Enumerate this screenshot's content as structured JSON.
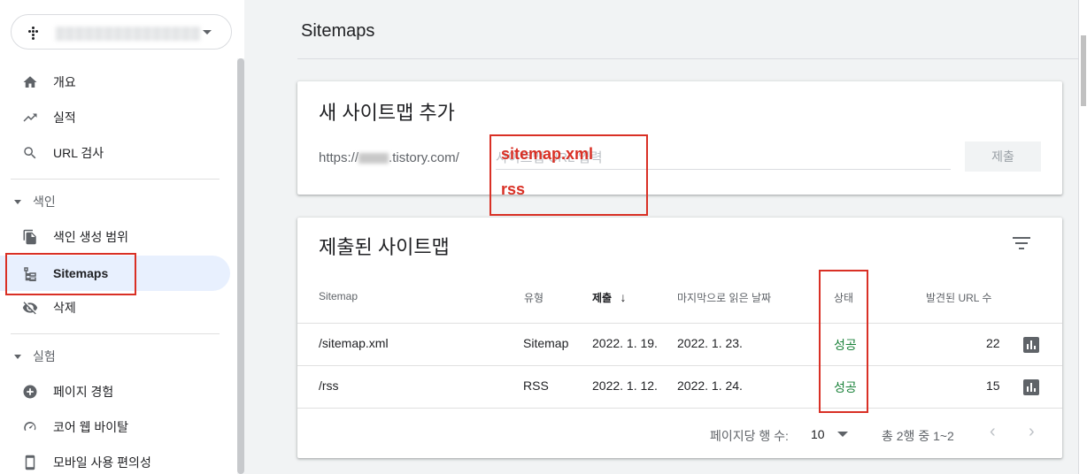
{
  "property": {
    "name": "▒▒▒▒▒▒▒▒▒▒▒▒▒▒▒"
  },
  "sidebar": {
    "items": [
      {
        "label": "개요",
        "icon": "home-icon"
      },
      {
        "label": "실적",
        "icon": "trending-up-icon"
      },
      {
        "label": "URL 검사",
        "icon": "search-icon"
      }
    ],
    "sections": [
      {
        "label": "색인",
        "items": [
          {
            "label": "색인 생성 범위",
            "icon": "file-copy-icon"
          },
          {
            "label": "Sitemaps",
            "icon": "sitemap-icon",
            "active": true
          },
          {
            "label": "삭제",
            "icon": "visibility-off-icon"
          }
        ]
      },
      {
        "label": "실험",
        "items": [
          {
            "label": "페이지 경험",
            "icon": "plus-circle-icon"
          },
          {
            "label": "코어 웹 바이탈",
            "icon": "speed-icon"
          },
          {
            "label": "모바일 사용 편의성",
            "icon": "smartphone-icon"
          }
        ]
      }
    ]
  },
  "main": {
    "title": "Sitemaps",
    "add_card": {
      "title": "새 사이트맵 추가",
      "url_prefix_start": "https://",
      "url_prefix_end": ".tistory.com/",
      "input_placeholder": "사이트맵 URL 입력",
      "submit_label": "제출"
    },
    "annotation": {
      "line1": "sitemap.xml",
      "line2": "rss"
    },
    "submitted_card": {
      "title": "제출된 사이트맵",
      "columns": [
        "Sitemap",
        "유형",
        "제출",
        "마지막으로 읽은 날짜",
        "상태",
        "발견된 URL 수"
      ],
      "rows": [
        {
          "sitemap": "/sitemap.xml",
          "type": "Sitemap",
          "submitted": "2022. 1. 19.",
          "last_read": "2022. 1. 23.",
          "status": "성공",
          "urls": "22"
        },
        {
          "sitemap": "/rss",
          "type": "RSS",
          "submitted": "2022. 1. 12.",
          "last_read": "2022. 1. 24.",
          "status": "성공",
          "urls": "15"
        }
      ],
      "pager": {
        "rows_per_page_label": "페이지당 행 수:",
        "rows_per_page": "10",
        "range": "총 2행 중 1~2"
      }
    }
  },
  "colors": {
    "accent": "#1a73e8",
    "success": "#188038",
    "annotation": "#d93025",
    "active_bg": "#e8f0fe"
  }
}
